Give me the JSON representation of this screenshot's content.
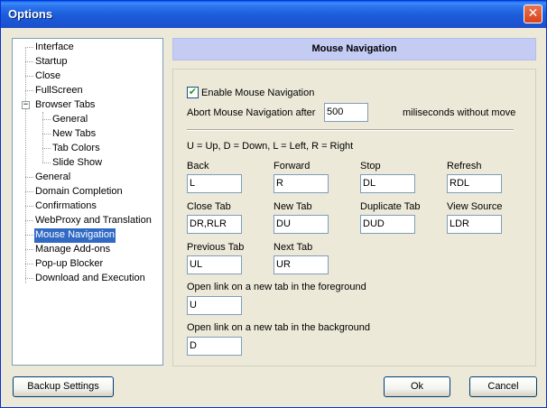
{
  "window": {
    "title": "Options",
    "close_glyph": "✕"
  },
  "tree": {
    "items": [
      "Interface",
      "Startup",
      "Close",
      "FullScreen",
      "Browser Tabs",
      "General",
      "New Tabs",
      "Tab Colors",
      "Slide Show",
      "General",
      "Domain Completion",
      "Confirmations",
      "WebProxy and Translation",
      "Mouse Navigation",
      "Manage Add-ons",
      "Pop-up Blocker",
      "Download and Execution"
    ],
    "selected": "Mouse Navigation",
    "expander_glyph": "−"
  },
  "panel": {
    "header": "Mouse Navigation",
    "enable": {
      "label": "Enable Mouse Navigation",
      "checked": true,
      "mark": "✔"
    },
    "abort": {
      "label_before": "Abort Mouse Navigation after",
      "value": "500",
      "label_after": "miliseconds without move"
    },
    "legend": "U = Up, D = Down, L = Left, R = Right",
    "gestures": [
      {
        "label": "Back",
        "value": "L"
      },
      {
        "label": "Forward",
        "value": "R"
      },
      {
        "label": "Stop",
        "value": "DL"
      },
      {
        "label": "Refresh",
        "value": "RDL"
      },
      {
        "label": "Close Tab",
        "value": "DR,RLR"
      },
      {
        "label": "New Tab",
        "value": "DU"
      },
      {
        "label": "Duplicate Tab",
        "value": "DUD"
      },
      {
        "label": "View Source",
        "value": "LDR"
      },
      {
        "label": "Previous Tab",
        "value": "UL"
      },
      {
        "label": "Next Tab",
        "value": "UR"
      }
    ],
    "fg": {
      "label": "Open link on a new tab in the foreground",
      "value": "U"
    },
    "bg": {
      "label": "Open link on a new tab in the background",
      "value": "D"
    }
  },
  "buttons": {
    "backup": "Backup Settings",
    "ok": "Ok",
    "cancel": "Cancel"
  }
}
